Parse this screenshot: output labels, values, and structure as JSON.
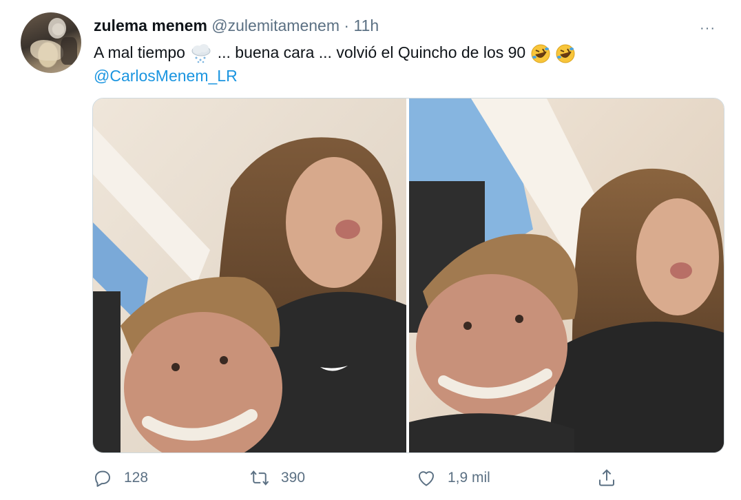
{
  "tweet": {
    "author_name": "zulema menem",
    "handle": "@zulemitamenem",
    "separator": "·",
    "time": "11h",
    "more_label": "···",
    "text": "A mal tiempo",
    "text_after_emoji": " ... buena cara ... volvió el Quincho de los 90",
    "emoji_1": "cloud-with-snow-icon",
    "emoji_2": "rolling-on-floor-laughing-icon",
    "mention": "@CarlosMenem_LR"
  },
  "media": {
    "photo_count": 2,
    "photos": [
      "selfie-left",
      "selfie-right"
    ]
  },
  "actions": {
    "reply_count": "128",
    "retweet_count": "390",
    "like_count": "1,9 mil",
    "reply_icon": "reply-icon",
    "retweet_icon": "retweet-icon",
    "like_icon": "like-icon",
    "share_icon": "share-icon"
  },
  "colors": {
    "text": "#0f1419",
    "secondary": "#5b7083",
    "link": "#1b95e0",
    "border": "#cfd9de"
  }
}
